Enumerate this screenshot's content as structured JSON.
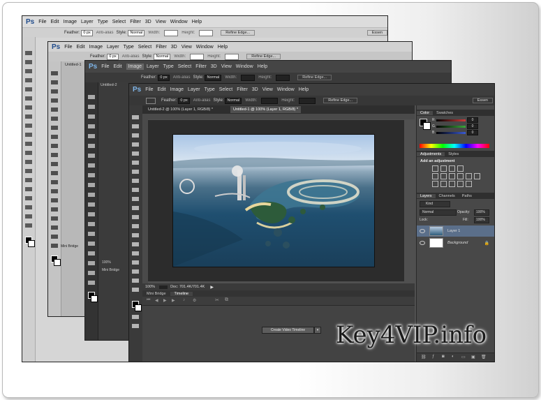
{
  "app_logo": "Ps",
  "menu": [
    "File",
    "Edit",
    "Image",
    "Layer",
    "Type",
    "Select",
    "Filter",
    "3D",
    "View",
    "Window",
    "Help"
  ],
  "options": {
    "feather_label": "Feather:",
    "feather_value": "0 px",
    "anti_alias": "Anti-alias",
    "style_label": "Style:",
    "style_value": "Normal",
    "width_label": "Width:",
    "height_label": "Height:",
    "refine_edge": "Refine Edge...",
    "workspace": "Essen"
  },
  "doc_tabs": {
    "w2_tab": "Untitled-1",
    "w3_tab": "Untitled-2",
    "tab1": "Untitled-2 @ 100% (Layer 1, RGB/8) *",
    "tab2": "Untitled-1 @ 100% (Layer 1, RGB/8) *"
  },
  "status": {
    "zoom": "100%",
    "doc": "Doc: 701.4K/701.4K"
  },
  "bottom_panel": {
    "mini_bridge": "Mini Bridge",
    "timeline": "Timeline",
    "create_video_timeline": "Create Video Timeline"
  },
  "color_panel": {
    "tab_color": "Color",
    "tab_swatches": "Swatches",
    "rows": [
      {
        "label": "R",
        "value": "0",
        "color": "#d33a3a"
      },
      {
        "label": "G",
        "value": "0",
        "color": "#3aa83a"
      },
      {
        "label": "B",
        "value": "0",
        "color": "#3a5ad3"
      }
    ]
  },
  "adjustments_panel": {
    "tab_adjustments": "Adjustments",
    "tab_styles": "Styles",
    "add_label": "Add an adjustment"
  },
  "layers_panel": {
    "tab_layers": "Layers",
    "tab_channels": "Channels",
    "tab_paths": "Paths",
    "kind": "Kind",
    "blend": "Normal",
    "opacity_label": "Opacity:",
    "opacity_value": "100%",
    "lock_label": "Lock:",
    "fill_label": "Fill:",
    "fill_value": "100%",
    "layers": [
      {
        "name": "Layer 1"
      },
      {
        "name": "Background"
      }
    ]
  },
  "watermark": "Key4VIP.info"
}
